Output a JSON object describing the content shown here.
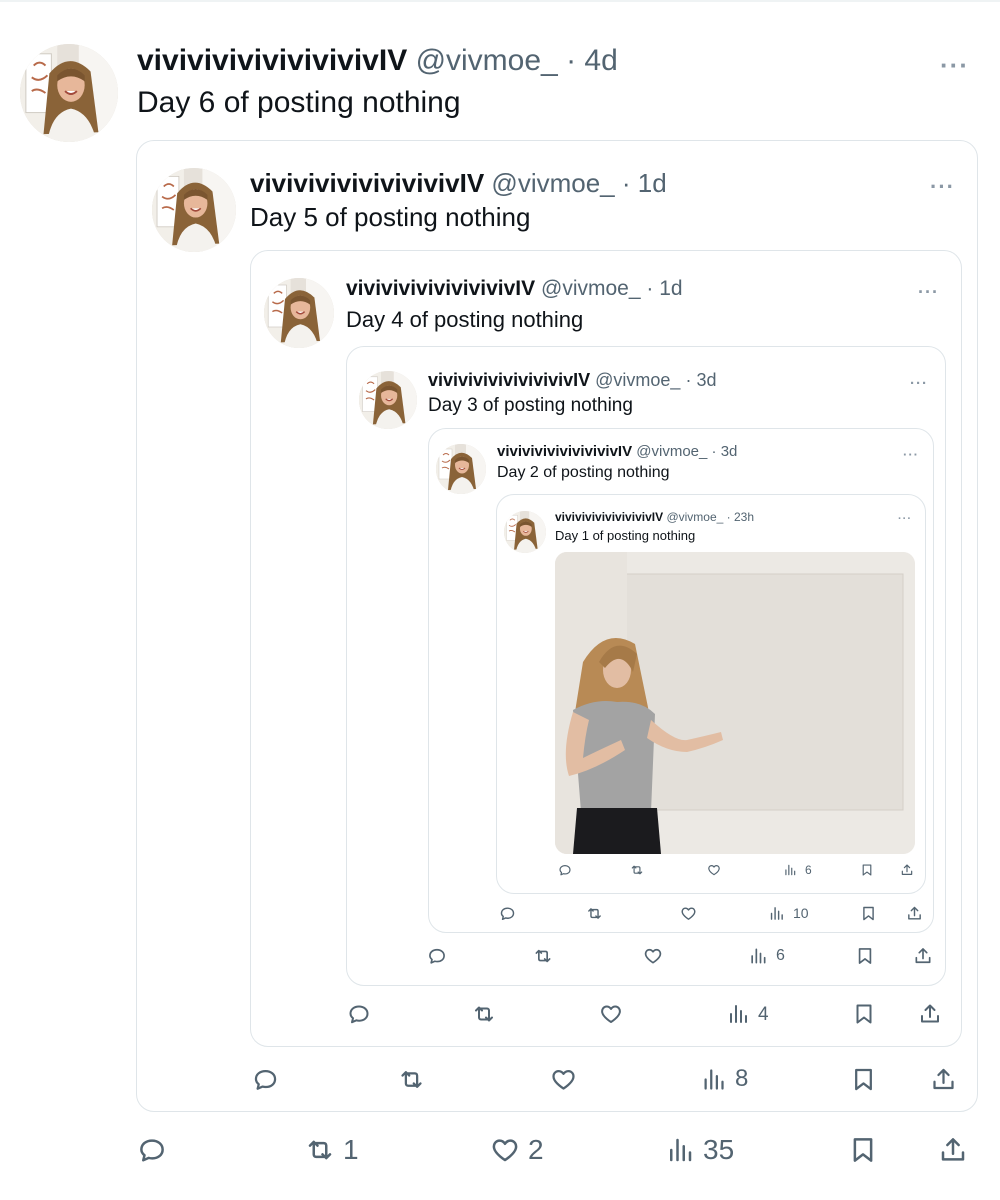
{
  "user": {
    "name": "vivivivivivivivivivIV",
    "handle": "@vivmoe_"
  },
  "tweets": [
    {
      "name": "vivivivivivivivivivIV",
      "handle": "@vivmoe_",
      "time": "4d",
      "text": "Day 6 of posting nothing",
      "stats": {
        "reply": "",
        "retweet": "1",
        "like": "2",
        "views": "35"
      }
    },
    {
      "name": "vivivivivivivivivivIV",
      "handle": "@vivmoe_",
      "time": "1d",
      "text": "Day 5 of posting nothing",
      "stats": {
        "reply": "",
        "retweet": "",
        "like": "",
        "views": "8"
      }
    },
    {
      "name": "vivivivivivivivivivIV",
      "handle": "@vivmoe_",
      "time": "1d",
      "text": "Day 4 of posting nothing",
      "stats": {
        "reply": "",
        "retweet": "",
        "like": "",
        "views": "4"
      }
    },
    {
      "name": "vivivivivivivivivivIV",
      "handle": "@vivmoe_",
      "time": "3d",
      "text": "Day 3 of posting nothing",
      "stats": {
        "reply": "",
        "retweet": "",
        "like": "",
        "views": "6"
      }
    },
    {
      "name": "vivivivivivivivivivIV",
      "handle": "@vivmoe_",
      "time": "3d",
      "text": "Day 2 of posting nothing",
      "stats": {
        "reply": "",
        "retweet": "",
        "like": "",
        "views": "10"
      }
    },
    {
      "name": "vivivivivivivivivivIV",
      "handle": "@vivmoe_",
      "time": "23h",
      "text": "Day 1 of posting nothing",
      "stats": {
        "reply": "",
        "retweet": "",
        "like": "",
        "views": "6"
      }
    }
  ],
  "separator": "·",
  "more_label": "···",
  "icons": {
    "reply": "reply-icon",
    "retweet": "retweet-icon",
    "like": "heart-icon",
    "views": "views-icon",
    "bookmark": "bookmark-icon",
    "share": "share-icon",
    "more": "more-icon"
  },
  "colors": {
    "text": "#0f1419",
    "secondary": "#536471",
    "border": "#dfe5e9"
  }
}
